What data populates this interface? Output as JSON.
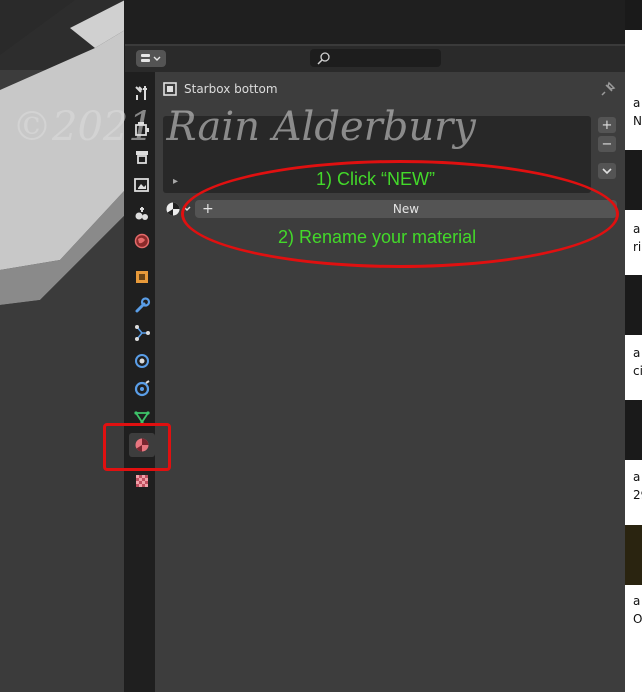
{
  "properties": {
    "object_name": "Starbox bottom",
    "new_button_label": "New",
    "new_button_plus": "+",
    "list_add": "+",
    "list_remove": "−",
    "expand_arrow": "▸",
    "active_tab": "material"
  },
  "tabs": [
    {
      "name": "tool",
      "icon": "tool-icon"
    },
    {
      "name": "render",
      "icon": "render-icon"
    },
    {
      "name": "output",
      "icon": "output-icon"
    },
    {
      "name": "view-layer",
      "icon": "view-layer-icon"
    },
    {
      "name": "scene",
      "icon": "scene-icon"
    },
    {
      "name": "world",
      "icon": "world-icon"
    },
    {
      "name": "object",
      "icon": "object-icon"
    },
    {
      "name": "modifiers",
      "icon": "wrench-icon"
    },
    {
      "name": "particles",
      "icon": "particles-icon"
    },
    {
      "name": "physics",
      "icon": "physics-icon"
    },
    {
      "name": "constraints",
      "icon": "constraints-icon"
    },
    {
      "name": "data",
      "icon": "mesh-data-icon"
    },
    {
      "name": "material",
      "icon": "material-icon"
    },
    {
      "name": "texture",
      "icon": "texture-icon"
    }
  ],
  "annotations": {
    "step1": "1) Click “NEW”",
    "step2": "2) Rename your material"
  },
  "watermark": "©2021 Rain Alderbury",
  "right_panel": {
    "snippets": [
      "a",
      "N",
      "a",
      "ri",
      "a",
      "ci",
      "a",
      "29",
      "a",
      "O"
    ]
  },
  "colors": {
    "annotation_green": "#43d92a",
    "highlight_red": "#e01010",
    "panel_bg": "#3d3d3d"
  }
}
